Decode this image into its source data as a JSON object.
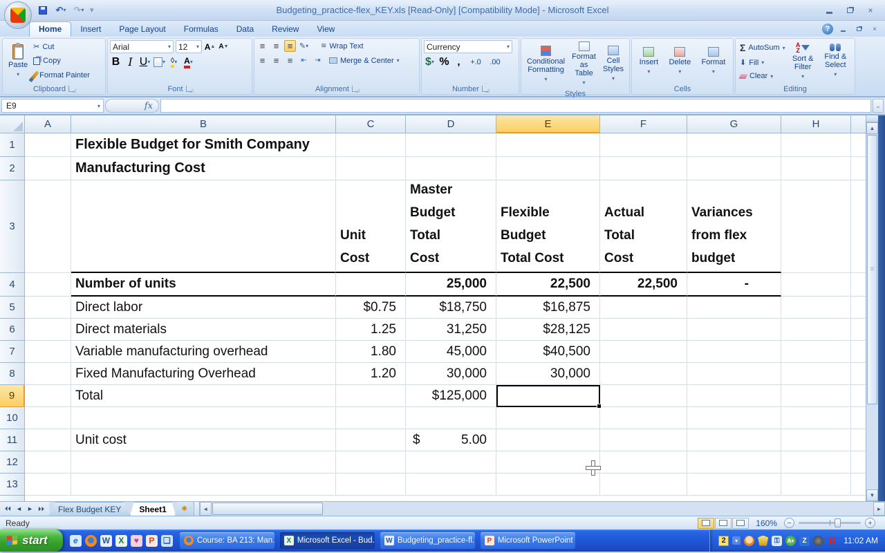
{
  "window": {
    "title": "Budgeting_practice-flex_KEY.xls  [Read-Only]  [Compatibility Mode] - Microsoft Excel"
  },
  "ribbon": {
    "tabs": [
      "Home",
      "Insert",
      "Page Layout",
      "Formulas",
      "Data",
      "Review",
      "View"
    ],
    "active_tab": "Home",
    "groups": {
      "clipboard": {
        "label": "Clipboard",
        "paste": "Paste",
        "cut": "Cut",
        "copy": "Copy",
        "format_painter": "Format Painter"
      },
      "font": {
        "label": "Font",
        "family": "Arial",
        "size": "12",
        "bold": "B",
        "italic": "I",
        "underline": "U",
        "grow": "A",
        "shrink": "A",
        "color": "A"
      },
      "alignment": {
        "label": "Alignment",
        "wrap_text": "Wrap Text",
        "merge_center": "Merge & Center"
      },
      "number": {
        "label": "Number",
        "format": "Currency",
        "currency": "$",
        "percent": "%",
        "comma": ",",
        "inc_dec": "+.0",
        "dec_dec": ".00"
      },
      "styles": {
        "label": "Styles",
        "conditional": "Conditional Formatting",
        "format_table": "Format as Table",
        "cell_styles": "Cell Styles"
      },
      "cells": {
        "label": "Cells",
        "insert": "Insert",
        "delete": "Delete",
        "format": "Format"
      },
      "editing": {
        "label": "Editing",
        "autosum_sigma": "Σ",
        "autosum": "AutoSum",
        "fill": "Fill",
        "clear": "Clear",
        "sort_filter": "Sort & Filter",
        "find_select": "Find & Select"
      }
    }
  },
  "formula_bar": {
    "name_box": "E9",
    "fx_label": "fx",
    "value": ""
  },
  "grid": {
    "columns": [
      "A",
      "B",
      "C",
      "D",
      "E",
      "F",
      "G",
      "H"
    ],
    "selected_column": "E",
    "rows": [
      "1",
      "2",
      "3",
      "4",
      "5",
      "6",
      "7",
      "8",
      "9",
      "10",
      "11",
      "12",
      "13"
    ],
    "selected_row": "9",
    "selected_cell": "E9",
    "cells": {
      "b1": "Flexible Budget for Smith Company",
      "b2": "Manufacturing Cost",
      "c3": "Unit\nCost",
      "d3": "Master\nBudget\nTotal\nCost",
      "e3": "Flexible\nBudget\nTotal Cost",
      "f3": "Actual\nTotal\nCost",
      "g3": "Variances\nfrom flex\nbudget",
      "b4": "Number of units",
      "d4": "25,000",
      "e4": "22,500",
      "f4": "22,500",
      "g4": "-",
      "b5": "Direct labor",
      "c5": "$0.75",
      "d5": "$18,750",
      "e5": "$16,875",
      "b6": "Direct materials",
      "c6": "1.25",
      "d6": "31,250",
      "e6": "$28,125",
      "b7": "Variable manufacturing overhead",
      "c7": "1.80",
      "d7": "45,000",
      "e7": "$40,500",
      "b8": "Fixed Manufacturing Overhead",
      "c8": "1.20",
      "d8": "30,000",
      "e8": "30,000",
      "b9": "Total",
      "d9": "$125,000",
      "b11": "Unit cost",
      "d11_currency": "$",
      "d11_value": "5.00"
    }
  },
  "sheet_bar": {
    "tabs": [
      "Flex Budget KEY",
      "Sheet1"
    ],
    "active_tab": "Sheet1"
  },
  "status_bar": {
    "mode": "Ready",
    "zoom_level": "160%"
  },
  "taskbar": {
    "start_label": "start",
    "windows": [
      "Course: BA 213: Man...",
      "Microsoft Excel - Bud...",
      "Budgeting_practice-fl...",
      "Microsoft PowerPoint ..."
    ],
    "tray_badge": "2",
    "clock": "11:02 AM"
  }
}
